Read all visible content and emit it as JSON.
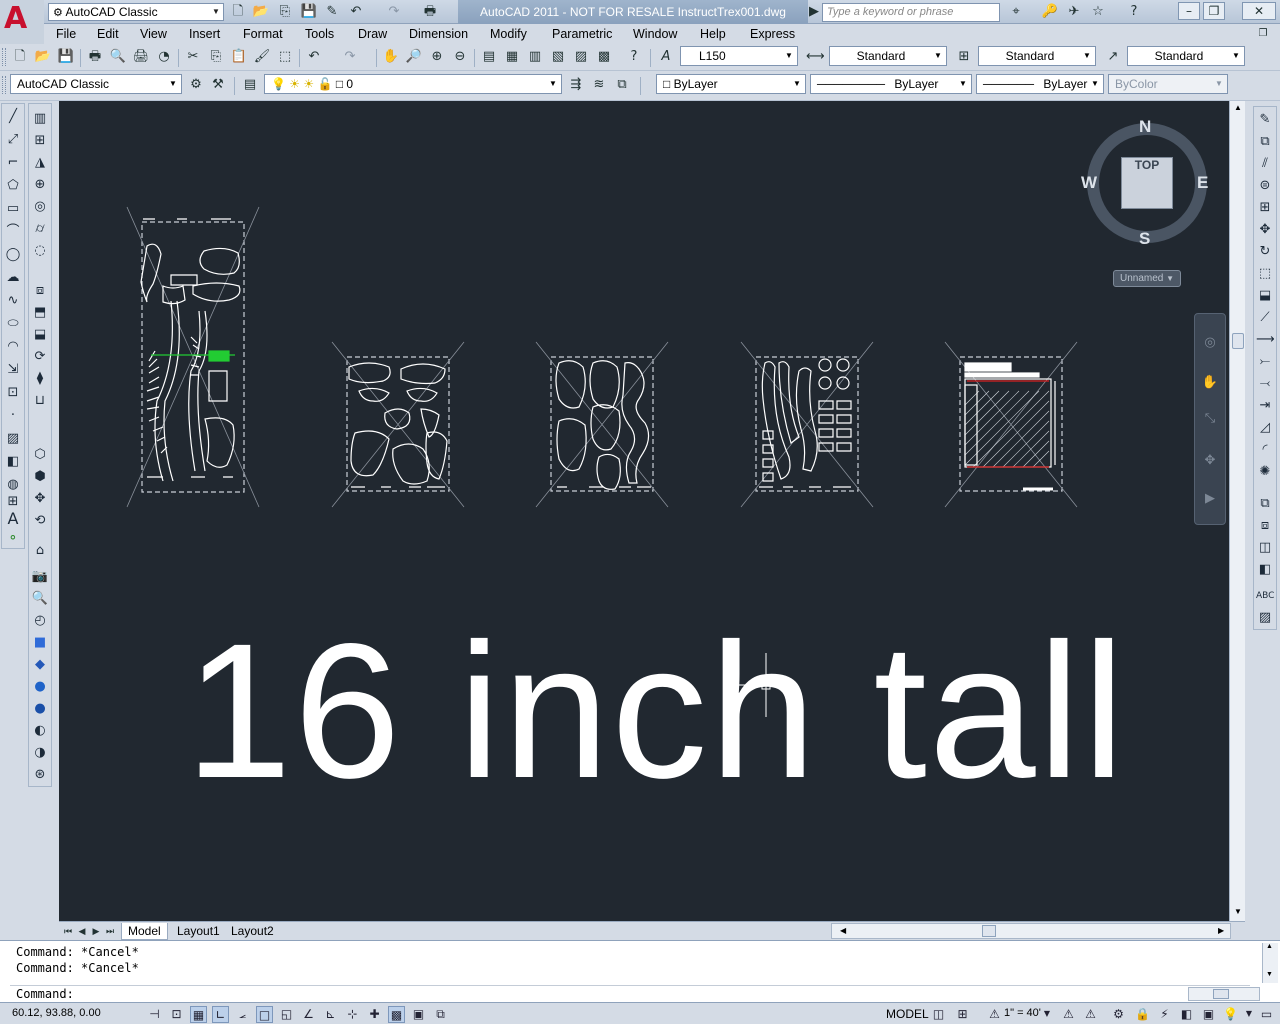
{
  "titlebar": {
    "workspace": "AutoCAD Classic",
    "title": "AutoCAD 2011 - NOT FOR RESALE    InstructTrex001.dwg",
    "search_placeholder": "Type a keyword or phrase"
  },
  "menubar": {
    "items": [
      "File",
      "Edit",
      "View",
      "Insert",
      "Format",
      "Tools",
      "Draw",
      "Dimension",
      "Modify",
      "Parametric",
      "Window",
      "Help",
      "Express"
    ]
  },
  "styles_toolbar": {
    "text_style": "L150",
    "dim_style": "Standard",
    "table_style": "Standard",
    "mleader_style": "Standard"
  },
  "layers_toolbar": {
    "workspace": "AutoCAD Classic",
    "current_layer": "0",
    "color": "ByLayer",
    "linetype": "ByLayer",
    "lineweight": "ByLayer",
    "plotstyle": "ByColor"
  },
  "viewcube": {
    "north": "N",
    "south": "S",
    "east": "E",
    "west": "W",
    "face": "TOP",
    "ucs": "Unnamed"
  },
  "drawing": {
    "annotation": "16 inch tall"
  },
  "tabs": {
    "model": "Model",
    "layout1": "Layout1",
    "layout2": "Layout2"
  },
  "command": {
    "line1": "Command: *Cancel*",
    "line2": "Command: *Cancel*",
    "prompt": "Command:"
  },
  "statusbar": {
    "coords": "60.12, 93.88, 0.00",
    "space": "MODEL",
    "scale": "1\" = 40'"
  },
  "colors": {
    "canvas": "#212830",
    "ui": "#d4dbe5",
    "accent": "#c8102e"
  }
}
